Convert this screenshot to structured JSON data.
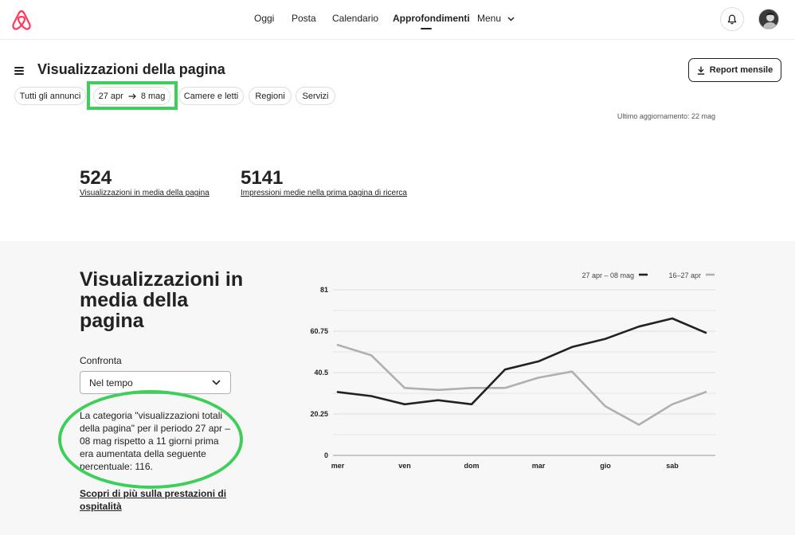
{
  "nav": {
    "items": [
      "Oggi",
      "Posta",
      "Calendario",
      "Approfondimenti",
      "Menu"
    ],
    "active": "Approfondimenti"
  },
  "page": {
    "title": "Visualizzazioni della pagina",
    "report_button": "Report mensile"
  },
  "filters": {
    "all_listings": "Tutti gli annunci",
    "date_from": "27 apr",
    "date_to": "8 mag",
    "rooms": "Camere e letti",
    "regions": "Regioni",
    "services": "Servizi"
  },
  "last_update": "Ultimo aggiornamento: 22 mag",
  "metrics": [
    {
      "value": "524",
      "label": "Visualizzazioni in media della pagina"
    },
    {
      "value": "5141",
      "label": "Impressioni medie nella prima pagina di ricerca"
    }
  ],
  "section": {
    "title": "Visualizzazioni in media della pagina",
    "compare_label": "Confronta",
    "compare_value": "Nel tempo",
    "description": "La categoria \"visualizzazioni totali della pagina\" per il periodo 27 apr – 08 mag rispetto a 11 giorni prima era aumentata della seguente percentuale: 116.",
    "learn_more": "Scopri di più sulla prestazioni di ospitalità"
  },
  "colors": {
    "highlight": "#3ecf5b",
    "series_current": "#222222",
    "series_previous": "#b0b0b0"
  },
  "chart_data": {
    "type": "line",
    "ylim": [
      0,
      81
    ],
    "y_ticks": [
      "81",
      "60.75",
      "40.5",
      "20.25",
      "0"
    ],
    "x_tick_labels": [
      "mer",
      "ven",
      "dom",
      "mar",
      "gio",
      "sab"
    ],
    "x_count": 12,
    "series": [
      {
        "name": "27 apr – 08 mag",
        "color": "#222222",
        "values": [
          31,
          29,
          25,
          27,
          25,
          42,
          46,
          53,
          57,
          63,
          67,
          60
        ]
      },
      {
        "name": "16–27 apr",
        "color": "#b0b0b0",
        "values": [
          54,
          49,
          33,
          32,
          33,
          33,
          38,
          41,
          24,
          15,
          25,
          31
        ]
      }
    ]
  }
}
